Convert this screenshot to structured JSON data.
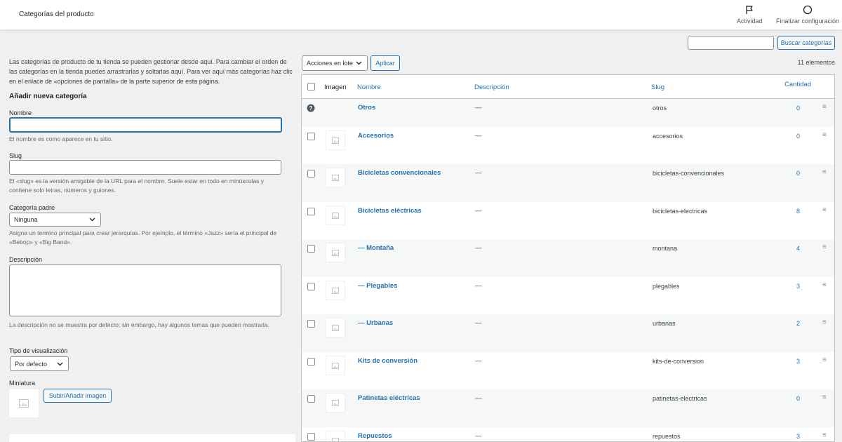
{
  "header": {
    "title": "Categorías del producto",
    "activity_label": "Actividad",
    "finish_label": "Finalizar configuración"
  },
  "search": {
    "value": "",
    "button_label": "Buscar categorías"
  },
  "form": {
    "intro": "Las categorías de producto de tu tienda se pueden gestionar desde aquí. Para cambiar el orden de las categorías en la tienda puedes arrastrarlas y soltarlas aquí. Para ver aquí más categorías haz clic en el enlace de «opciones de pantalla» de la parte superior de esta página.",
    "heading": "Añadir nueva categoría",
    "name_label": "Nombre",
    "name_value": "",
    "name_help": "El nombre es como aparece en tu sitio.",
    "slug_label": "Slug",
    "slug_value": "",
    "slug_help": "El «slug» es la versión amigable de la URL para el nombre. Suele estar en todo en minúsculas y contiene solo letras, números y guiones.",
    "parent_label": "Categoría padre",
    "parent_value": "Ninguna",
    "parent_help": "Asigna un termino principal para crear jerarquías. Por ejemplo, el término «Jazz» sería el principal de «Bebop» y «Big Band».",
    "description_label": "Descripción",
    "description_value": "",
    "description_help": "La descripción no se muestra por defecto; sin embargo, hay algunos temas que pueden mostrarla.",
    "display_type_label": "Tipo de visualización",
    "display_type_value": "Por defecto",
    "thumbnail_label": "Miniatura",
    "upload_button": "Subir/Añadir imagen"
  },
  "toolbar": {
    "bulk_actions": "Acciones en lote",
    "apply_label": "Aplicar",
    "item_count": "11 elementos"
  },
  "table": {
    "columns": {
      "image": "Imagen",
      "name": "Nombre",
      "description": "Descripción",
      "slug": "Slug",
      "count": "Cantidad"
    },
    "rows": [
      {
        "name": "Otros",
        "description": "—",
        "slug": "otros",
        "count": "0",
        "icon": "help-icon"
      },
      {
        "name": "Accesorios",
        "description": "—",
        "slug": "accesorios",
        "count": "0",
        "icon": "image-placeholder-icon"
      },
      {
        "name": "Bicicletas convencionales",
        "description": "—",
        "slug": "bicicletas-convencionales",
        "count": "0",
        "icon": "image-placeholder-icon"
      },
      {
        "name": "Bicicletas eléctricas",
        "description": "—",
        "slug": "bicicletas-electricas",
        "count": "8",
        "icon": "image-placeholder-icon"
      },
      {
        "name": "— Montaña",
        "description": "—",
        "slug": "montana",
        "count": "4",
        "icon": "image-placeholder-icon"
      },
      {
        "name": "— Plegables",
        "description": "—",
        "slug": "plegables",
        "count": "3",
        "icon": "image-placeholder-icon"
      },
      {
        "name": "— Urbanas",
        "description": "—",
        "slug": "urbanas",
        "count": "2",
        "icon": "image-placeholder-icon"
      },
      {
        "name": "Kits de conversión",
        "description": "—",
        "slug": "kits-de-conversion",
        "count": "3",
        "icon": "image-placeholder-icon"
      },
      {
        "name": "Patinetas eléctricas",
        "description": "—",
        "slug": "patinetas-electricas",
        "count": "0",
        "icon": "image-placeholder-icon"
      },
      {
        "name": "Repuestos",
        "description": "—",
        "slug": "repuestos",
        "count": "3",
        "icon": "image-placeholder-icon"
      }
    ]
  },
  "colors": {
    "accent": "#2271b1",
    "background": "#f0f0f1",
    "row_alt": "#f6f7f7"
  }
}
